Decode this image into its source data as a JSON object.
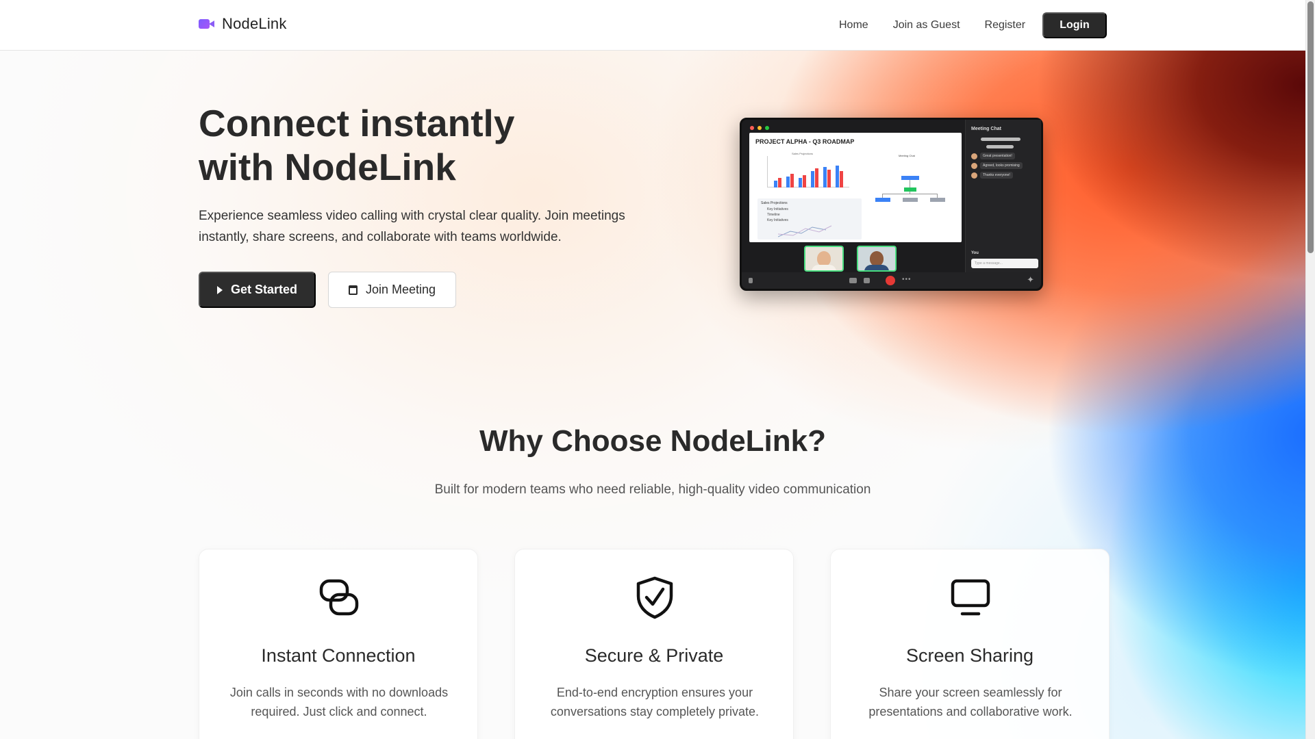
{
  "nav": {
    "brand": "NodeLink",
    "links": [
      "Home",
      "Join as Guest",
      "Register"
    ],
    "login_label": "Login"
  },
  "hero": {
    "title_line1": "Connect instantly",
    "title_line2": "with NodeLink",
    "subtitle": "Experience seamless video calling with crystal clear quality. Join meetings instantly, share screens, and collaborate with teams worldwide.",
    "primary_button": "Get Started",
    "secondary_button": "Join Meeting"
  },
  "mockup": {
    "slide_title": "PROJECT ALPHA - Q3 ROADMAP",
    "chart_caption": "Sales Projections",
    "box_title": "Sales Projections",
    "bullets": [
      "Key Initiatives",
      "Timeline",
      "Key Initiatives"
    ],
    "org_title": "Meeting Chat",
    "chat_title": "Meeting Chat",
    "chat_messages": [
      "Great presentation!",
      "Agreed, looks promising",
      "Thanks everyone!"
    ],
    "chat_you": "You",
    "chat_placeholder": "Type a message..."
  },
  "why": {
    "title": "Why Choose NodeLink?",
    "subtitle": "Built for modern teams who need reliable, high-quality video communication"
  },
  "features": [
    {
      "title": "Instant Connection",
      "desc": "Join calls in seconds with no downloads required. Just click and connect.",
      "icon": "link-icon"
    },
    {
      "title": "Secure & Private",
      "desc": "End-to-end encryption ensures your conversations stay completely private.",
      "icon": "shield-check-icon"
    },
    {
      "title": "Screen Sharing",
      "desc": "Share your screen seamlessly for presentations and collaborative work.",
      "icon": "monitor-icon"
    }
  ],
  "colors": {
    "accent_dark": "#2a2a2a",
    "brand_purple": "#8b5cf6",
    "tile_border": "#4ade80",
    "end_call": "#e53935"
  }
}
